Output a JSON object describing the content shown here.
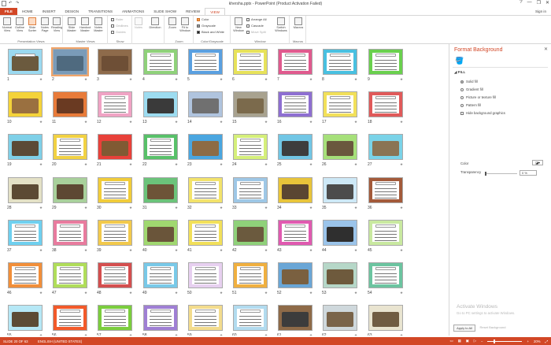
{
  "window": {
    "title": "khersha.pptx - PowerPoint (Product Activation Failed)",
    "controls": [
      "?",
      "—",
      "❐",
      "✕"
    ]
  },
  "tabs": [
    "FILE",
    "HOME",
    "INSERT",
    "DESIGN",
    "TRANSITIONS",
    "ANIMATIONS",
    "SLIDE SHOW",
    "REVIEW",
    "VIEW"
  ],
  "active_tab": "VIEW",
  "signin": "Sign in",
  "ribbon": {
    "groups": {
      "presentation_views": "Presentation Views",
      "master_views": "Master Views",
      "show": "Show",
      "zoom": "Zoom",
      "color_grayscale": "Color/Grayscale",
      "window": "Window",
      "macros": "Macros"
    },
    "buttons": {
      "normal": "Normal View",
      "outline": "Outline View",
      "slide_sorter": "Slide Sorter",
      "notes_page": "Notes Page",
      "reading_view": "Reading View",
      "slide_master": "Slide Master",
      "handout_master": "Handout Master",
      "notes_master": "Notes Master",
      "notes": "Notes",
      "zoom": "Zoom",
      "fit_to_window": "Fit to Window",
      "new_window": "New Window",
      "switch_windows": "Switch Windows",
      "macros": "Macros"
    },
    "show_items": [
      "Ruler",
      "Gridlines",
      "Guides"
    ],
    "direction_label": "Direction",
    "color_options": [
      "Color",
      "Grayscale",
      "Black and White"
    ],
    "window_options": [
      "Arrange All",
      "Cascade",
      "Move Split"
    ]
  },
  "slides": {
    "count": 63,
    "selected": 2,
    "thumbs": [
      {
        "n": 1,
        "frame": "#9bd9f0",
        "title": "#fff",
        "photo": "#6b5a3e"
      },
      {
        "n": 2,
        "frame": "#7a9bb8",
        "title": "",
        "photo": "#4f6a7f"
      },
      {
        "n": 3,
        "frame": "#8e6b4b",
        "title": "",
        "photo": "#6e4f36"
      },
      {
        "n": 4,
        "frame": "#8fd17a",
        "title": "#fff",
        "photo": ""
      },
      {
        "n": 5,
        "frame": "#5aa0e0",
        "title": "#fff",
        "photo": ""
      },
      {
        "n": 6,
        "frame": "#e7e25a",
        "title": "#fff",
        "photo": ""
      },
      {
        "n": 7,
        "frame": "#e05a8e",
        "title": "#fff",
        "photo": ""
      },
      {
        "n": 8,
        "frame": "#49c0e0",
        "title": "#fff",
        "photo": ""
      },
      {
        "n": 9,
        "frame": "#6ad04e",
        "title": "#fff",
        "photo": ""
      },
      {
        "n": 10,
        "frame": "#f4d33a",
        "title": "",
        "photo": "#9a7040"
      },
      {
        "n": 11,
        "frame": "#e87b3a",
        "title": "",
        "photo": "#6a3a22"
      },
      {
        "n": 12,
        "frame": "#f0a3c4",
        "title": "#fff",
        "photo": ""
      },
      {
        "n": 13,
        "frame": "#9ddcf0",
        "title": "",
        "photo": "#3a3a3a"
      },
      {
        "n": 14,
        "frame": "#b0c4de",
        "title": "",
        "photo": "#707070"
      },
      {
        "n": 15,
        "frame": "#a8a28f",
        "title": "",
        "photo": "#7b6a4c"
      },
      {
        "n": 16,
        "frame": "#8e6fd1",
        "title": "#fff",
        "photo": ""
      },
      {
        "n": 17,
        "frame": "#f2e05a",
        "title": "#fff",
        "photo": ""
      },
      {
        "n": 18,
        "frame": "#e05a5a",
        "title": "#fff",
        "photo": ""
      },
      {
        "n": 19,
        "frame": "#7fd0e8",
        "title": "",
        "photo": "#5b4a36"
      },
      {
        "n": 20,
        "frame": "#f1d143",
        "title": "#fff",
        "photo": ""
      },
      {
        "n": 21,
        "frame": "#e8413a",
        "title": "",
        "photo": "#805a33"
      },
      {
        "n": 22,
        "frame": "#58c069",
        "title": "#fff",
        "photo": ""
      },
      {
        "n": 23,
        "frame": "#4aa6e0",
        "title": "",
        "photo": "#8d6b45"
      },
      {
        "n": 24,
        "frame": "#d5ef7a",
        "title": "#fff",
        "photo": ""
      },
      {
        "n": 25,
        "frame": "#71c6e5",
        "title": "",
        "photo": "#3d3d3d"
      },
      {
        "n": 26,
        "frame": "#a6e07a",
        "title": "",
        "photo": "#6a583e"
      },
      {
        "n": 27,
        "frame": "#7ad3e8",
        "title": "",
        "photo": "#8a7454"
      },
      {
        "n": 28,
        "frame": "#e4e1c6",
        "title": "",
        "photo": "#5c4a34"
      },
      {
        "n": 29,
        "frame": "#a8d09b",
        "title": "",
        "photo": "#5d4833"
      },
      {
        "n": 30,
        "frame": "#f1cc3a",
        "title": "#fff",
        "photo": ""
      },
      {
        "n": 31,
        "frame": "#6bc37a",
        "title": "",
        "photo": "#6d5438"
      },
      {
        "n": 32,
        "frame": "#f3e36b",
        "title": "#fff",
        "photo": ""
      },
      {
        "n": 33,
        "frame": "#9ec7e6",
        "title": "#fff",
        "photo": ""
      },
      {
        "n": 34,
        "frame": "#e8c43a",
        "title": "",
        "photo": "#5a4632"
      },
      {
        "n": 35,
        "frame": "#cde8f6",
        "title": "",
        "photo": "#4c4c4c"
      },
      {
        "n": 36,
        "frame": "#a35a3a",
        "title": "#fff",
        "photo": ""
      },
      {
        "n": 37,
        "frame": "#6fd0ef",
        "title": "#fff",
        "photo": ""
      },
      {
        "n": 38,
        "frame": "#e87b9e",
        "title": "#fff",
        "photo": ""
      },
      {
        "n": 39,
        "frame": "#f2c94c",
        "title": "#fff",
        "photo": ""
      },
      {
        "n": 40,
        "frame": "#a0d870",
        "title": "",
        "photo": "#6a553a"
      },
      {
        "n": 41,
        "frame": "#f2e05a",
        "title": "#fff",
        "photo": ""
      },
      {
        "n": 42,
        "frame": "#8fd17a",
        "title": "",
        "photo": "#6b5a3e"
      },
      {
        "n": 43,
        "frame": "#e05ab0",
        "title": "#fff",
        "photo": ""
      },
      {
        "n": 44,
        "frame": "#9bc4ea",
        "title": "",
        "photo": "#2f2f2f"
      },
      {
        "n": 45,
        "frame": "#c9e9a0",
        "title": "#fff",
        "photo": ""
      },
      {
        "n": 46,
        "frame": "#f18f3a",
        "title": "#fff",
        "photo": ""
      },
      {
        "n": 47,
        "frame": "#b0dd5a",
        "title": "#fff",
        "photo": ""
      },
      {
        "n": 48,
        "frame": "#d44f4f",
        "title": "#fff",
        "photo": ""
      },
      {
        "n": 49,
        "frame": "#79c9e8",
        "title": "#fff",
        "photo": ""
      },
      {
        "n": 50,
        "frame": "#e7d0f0",
        "title": "#fff",
        "photo": ""
      },
      {
        "n": 51,
        "frame": "#f0b040",
        "title": "#fff",
        "photo": ""
      },
      {
        "n": 52,
        "frame": "#6aa6d6",
        "title": "",
        "photo": "#7a6040"
      },
      {
        "n": 53,
        "frame": "#b6d7c8",
        "title": "",
        "photo": "#6e5a3d"
      },
      {
        "n": 54,
        "frame": "#6cc4a0",
        "title": "#fff",
        "photo": ""
      },
      {
        "n": 55,
        "frame": "#b6e8f6",
        "title": "",
        "photo": "#5c4b35"
      },
      {
        "n": 56,
        "frame": "#f25a2a",
        "title": "#fff",
        "photo": ""
      },
      {
        "n": 57,
        "frame": "#7bcd3e",
        "title": "#fff",
        "photo": ""
      },
      {
        "n": 58,
        "frame": "#9f7fd4",
        "title": "#fff",
        "photo": ""
      },
      {
        "n": 59,
        "frame": "#f3dc8d",
        "title": "#fff",
        "photo": ""
      },
      {
        "n": 60,
        "frame": "#b2dbef",
        "title": "#fff",
        "photo": ""
      },
      {
        "n": 61,
        "frame": "#8e6a48",
        "title": "",
        "photo": "#3c3c3c"
      },
      {
        "n": 62,
        "frame": "#cfd8dc",
        "title": "",
        "photo": "#7a644a"
      },
      {
        "n": 63,
        "frame": "#e9e4d0",
        "title": "",
        "photo": "#705c42"
      }
    ]
  },
  "format_pane": {
    "title": "Format Background",
    "section": "FILL",
    "options": [
      "Solid fill",
      "Gradient fill",
      "Picture or texture fill",
      "Pattern fill"
    ],
    "selected_option": "Solid fill",
    "hide_graphics": "Hide background graphics",
    "color_label": "Color",
    "transparency_label": "Transparency",
    "transparency_value": "0 %",
    "transparency_level": 0,
    "apply_all": "Apply to All",
    "reset": "Reset Background"
  },
  "watermark": {
    "line1": "Activate Windows",
    "line2": "Go to PC settings to activate Windows."
  },
  "statusbar": {
    "slide": "SLIDE 20 OF 63",
    "language": "ENGLISH (UNITED STATES)",
    "zoom": "20%"
  },
  "colors": {
    "accent": "#d24726",
    "selection": "#f0a46a"
  }
}
